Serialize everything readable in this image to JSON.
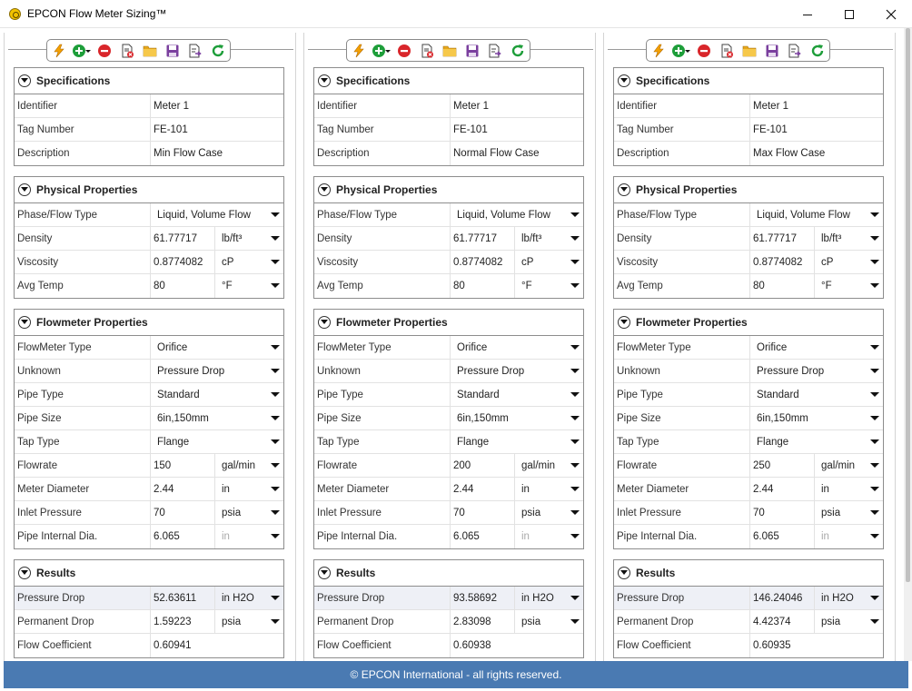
{
  "window": {
    "title": "EPCON Flow Meter Sizing™"
  },
  "footer": {
    "text": "© EPCON International - all rights reserved."
  },
  "sections": {
    "specifications": "Specifications",
    "physical": "Physical Properties",
    "flowmeter": "Flowmeter Properties",
    "results": "Results"
  },
  "labels": {
    "identifier": "Identifier",
    "tag_number": "Tag Number",
    "description": "Description",
    "phase_flow_type": "Phase/Flow Type",
    "density": "Density",
    "viscosity": "Viscosity",
    "avg_temp": "Avg Temp",
    "flowmeter_type": "FlowMeter Type",
    "unknown": "Unknown",
    "pipe_type": "Pipe Type",
    "pipe_size": "Pipe Size",
    "tap_type": "Tap Type",
    "flowrate": "Flowrate",
    "meter_diameter": "Meter Diameter",
    "inlet_pressure": "Inlet Pressure",
    "pipe_internal_dia": "Pipe Internal Dia.",
    "pressure_drop": "Pressure Drop",
    "permanent_drop": "Permanent Drop",
    "flow_coefficient": "Flow Coefficient"
  },
  "columns": [
    {
      "identifier": "Meter 1",
      "tag_number": "FE-101",
      "description": "Min Flow Case",
      "phase_flow_type": "Liquid, Volume Flow",
      "density": "61.77717",
      "density_unit": "lb/ft³",
      "viscosity": "0.8774082",
      "viscosity_unit": "cP",
      "avg_temp": "80",
      "temp_unit": "°F",
      "flowmeter_type": "Orifice",
      "unknown": "Pressure Drop",
      "pipe_type": "Standard",
      "pipe_size": "6in,150mm",
      "tap_type": "Flange",
      "flowrate": "150",
      "flowrate_unit": "gal/min",
      "meter_diameter": "2.44",
      "meter_diameter_unit": "in",
      "inlet_pressure": "70",
      "inlet_pressure_unit": "psia",
      "pipe_internal_dia": "6.065",
      "pipe_internal_dia_unit": "in",
      "pressure_drop": "52.63611",
      "pressure_drop_unit": "in H2O",
      "permanent_drop": "1.59223",
      "permanent_drop_unit": "psia",
      "flow_coefficient": "0.60941"
    },
    {
      "identifier": "Meter 1",
      "tag_number": "FE-101",
      "description": "Normal Flow Case",
      "phase_flow_type": "Liquid, Volume Flow",
      "density": "61.77717",
      "density_unit": "lb/ft³",
      "viscosity": "0.8774082",
      "viscosity_unit": "cP",
      "avg_temp": "80",
      "temp_unit": "°F",
      "flowmeter_type": "Orifice",
      "unknown": "Pressure Drop",
      "pipe_type": "Standard",
      "pipe_size": "6in,150mm",
      "tap_type": "Flange",
      "flowrate": "200",
      "flowrate_unit": "gal/min",
      "meter_diameter": "2.44",
      "meter_diameter_unit": "in",
      "inlet_pressure": "70",
      "inlet_pressure_unit": "psia",
      "pipe_internal_dia": "6.065",
      "pipe_internal_dia_unit": "in",
      "pressure_drop": "93.58692",
      "pressure_drop_unit": "in H2O",
      "permanent_drop": "2.83098",
      "permanent_drop_unit": "psia",
      "flow_coefficient": "0.60938"
    },
    {
      "identifier": "Meter 1",
      "tag_number": "FE-101",
      "description": "Max Flow Case",
      "phase_flow_type": "Liquid, Volume Flow",
      "density": "61.77717",
      "density_unit": "lb/ft³",
      "viscosity": "0.8774082",
      "viscosity_unit": "cP",
      "avg_temp": "80",
      "temp_unit": "°F",
      "flowmeter_type": "Orifice",
      "unknown": "Pressure Drop",
      "pipe_type": "Standard",
      "pipe_size": "6in,150mm",
      "tap_type": "Flange",
      "flowrate": "250",
      "flowrate_unit": "gal/min",
      "meter_diameter": "2.44",
      "meter_diameter_unit": "in",
      "inlet_pressure": "70",
      "inlet_pressure_unit": "psia",
      "pipe_internal_dia": "6.065",
      "pipe_internal_dia_unit": "in",
      "pressure_drop": "146.24046",
      "pressure_drop_unit": "in H2O",
      "permanent_drop": "4.42374",
      "permanent_drop_unit": "psia",
      "flow_coefficient": "0.60935"
    }
  ],
  "toolbar_icons": [
    "calculate-icon",
    "add-icon",
    "remove-icon",
    "clear-icon",
    "open-folder-icon",
    "save-icon",
    "export-icon",
    "refresh-icon"
  ],
  "colors": {
    "footer": "#4a7ab2",
    "calc": "#f4a100",
    "add": "#1e9e3a",
    "remove": "#d9262b",
    "folder": "#e8a81c",
    "save": "#7a3f9e",
    "refresh": "#1e9e3a"
  }
}
